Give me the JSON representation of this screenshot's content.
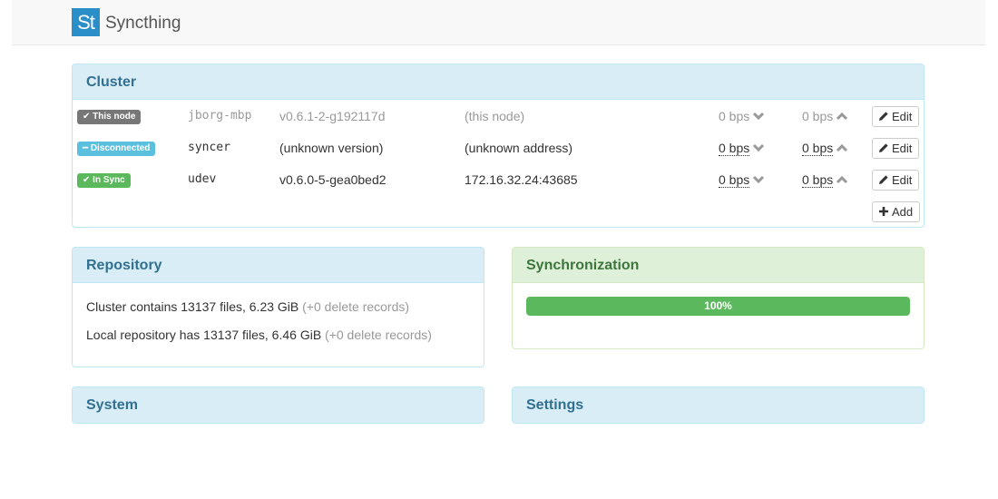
{
  "app": {
    "logo_text": "St",
    "brand": "Syncthing"
  },
  "cluster": {
    "title": "Cluster",
    "nodes": [
      {
        "status": "This node",
        "status_icon": "check-icon",
        "status_color": "#777777",
        "name": "jborg-mbp",
        "version": "v0.6.1-2-g192117d",
        "address": "(this node)",
        "rate_in": "0 bps",
        "rate_out": "0 bps",
        "edit_label": "Edit"
      },
      {
        "status": "Disconnected",
        "status_icon": "minus-icon",
        "status_color": "#5bc0de",
        "name": "syncer",
        "version": "(unknown version)",
        "address": "(unknown address)",
        "rate_in": "0 bps",
        "rate_out": "0 bps",
        "edit_label": "Edit"
      },
      {
        "status": "In Sync",
        "status_icon": "check-icon",
        "status_color": "#5cb85c",
        "name": "udev",
        "version": "v0.6.0-5-gea0bed2",
        "address": "172.16.32.24:43685",
        "rate_in": "0 bps",
        "rate_out": "0 bps",
        "edit_label": "Edit"
      }
    ],
    "add_label": "Add"
  },
  "repository": {
    "title": "Repository",
    "cluster_line": "Cluster contains 13137 files, 6.23 GiB",
    "cluster_deleted": "(+0 delete records)",
    "local_line": "Local repository has 13137 files, 6.46 GiB",
    "local_deleted": "(+0 delete records)"
  },
  "synchronization": {
    "title": "Synchronization",
    "progress": 1.0,
    "progress_label": "100%",
    "bar_color": "#5cb85c"
  },
  "system": {
    "title": "System"
  },
  "settings": {
    "title": "Settings"
  }
}
